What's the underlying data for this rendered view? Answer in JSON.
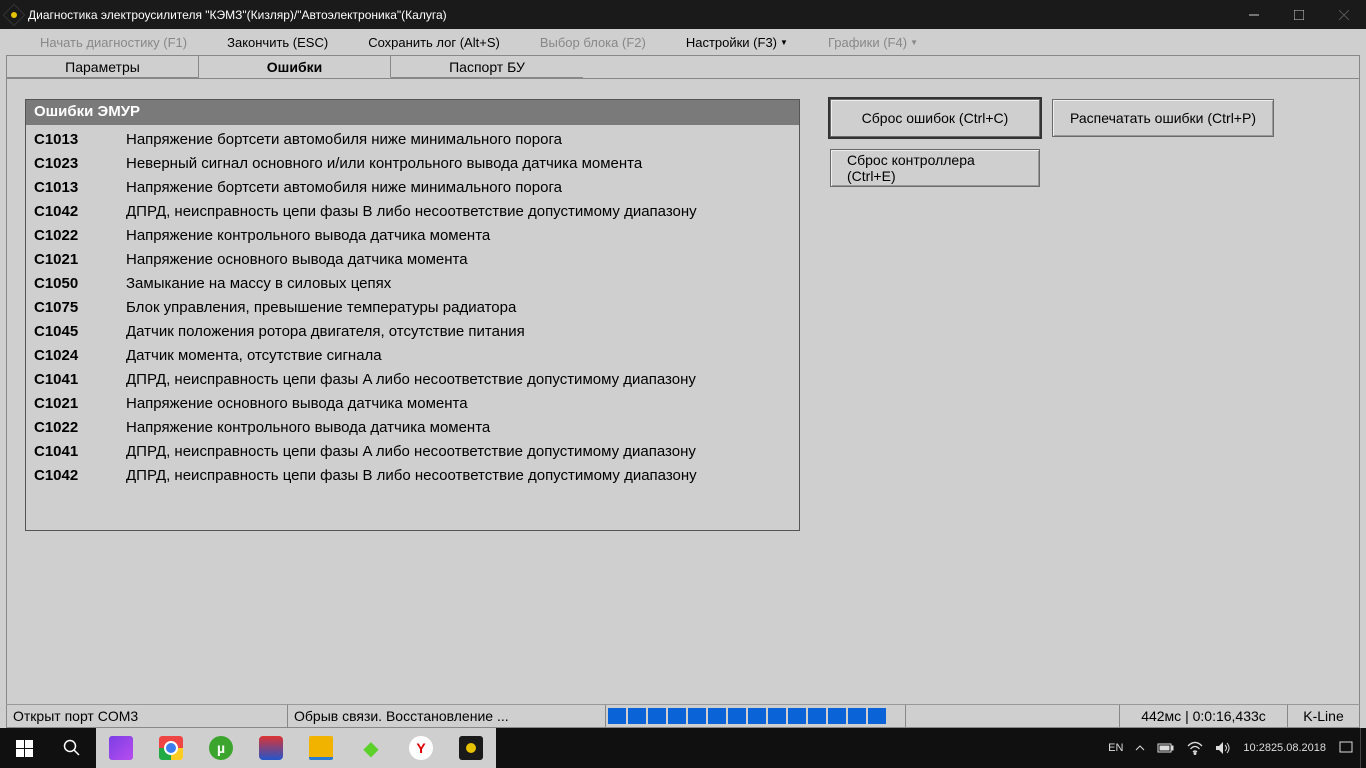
{
  "titlebar": {
    "title": "Диагностика электроусилителя \"КЭМЗ\"(Кизляр)/\"Автоэлектроника\"(Калуга)"
  },
  "menu": {
    "start": "Начать диагностику (F1)",
    "stop": "Закончить (ESC)",
    "save": "Сохранить лог (Alt+S)",
    "block": "Выбор блока (F2)",
    "settings": "Настройки (F3)",
    "charts": "Графики (F4)"
  },
  "tabs": {
    "params": "Параметры",
    "errors": "Ошибки",
    "passport": "Паспорт БУ"
  },
  "errors": {
    "header": "Ошибки ЭМУР",
    "rows": [
      {
        "code": "C1013",
        "desc": "Напряжение бортсети автомобиля ниже минимального порога"
      },
      {
        "code": "C1023",
        "desc": "Неверный сигнал основного и/или контрольного вывода датчика момента"
      },
      {
        "code": "C1013",
        "desc": "Напряжение бортсети автомобиля ниже минимального порога"
      },
      {
        "code": "C1042",
        "desc": "ДПРД, неисправность цепи фазы B либо несоответствие допустимому диапазону"
      },
      {
        "code": "C1022",
        "desc": "Напряжение контрольного вывода датчика момента"
      },
      {
        "code": "C1021",
        "desc": "Напряжение основного вывода датчика момента"
      },
      {
        "code": "C1050",
        "desc": "Замыкание на массу в силовых цепях"
      },
      {
        "code": "C1075",
        "desc": "Блок управления, превышение температуры радиатора"
      },
      {
        "code": "C1045",
        "desc": "Датчик положения ротора двигателя, отсутствие питания"
      },
      {
        "code": "C1024",
        "desc": "Датчик момента, отсутствие сигнала"
      },
      {
        "code": "C1041",
        "desc": "ДПРД, неисправность цепи фазы A либо несоответствие допустимому диапазону"
      },
      {
        "code": "C1021",
        "desc": "Напряжение основного вывода датчика момента"
      },
      {
        "code": "C1022",
        "desc": "Напряжение контрольного вывода датчика момента"
      },
      {
        "code": "C1041",
        "desc": "ДПРД, неисправность цепи фазы A либо несоответствие допустимому диапазону"
      },
      {
        "code": "C1042",
        "desc": "ДПРД, неисправность цепи фазы B либо несоответствие допустимому диапазону"
      }
    ]
  },
  "buttons": {
    "clear_errors": "Сброс ошибок (Ctrl+C)",
    "print_errors": "Распечатать ошибки (Ctrl+P)",
    "reset_controller": "Сброс контроллера (Ctrl+E)"
  },
  "status": {
    "port": "Открыт порт COM3",
    "conn": "Обрыв связи. Восстановление ...",
    "timing": "442мс | 0:0:16,433с",
    "protocol": "K-Line"
  },
  "taskbar": {
    "lang": "EN",
    "time": "10:28",
    "date": "25.08.2018"
  }
}
